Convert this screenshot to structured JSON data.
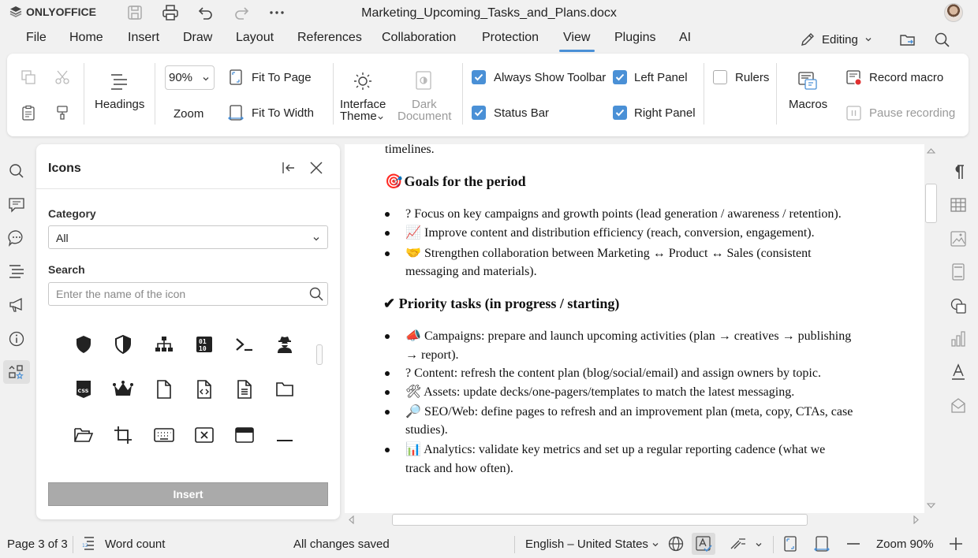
{
  "app": {
    "name": "ONLYOFFICE",
    "document_title": "Marketing_Upcoming_Tasks_and_Plans.docx"
  },
  "menu": {
    "items": [
      "File",
      "Home",
      "Insert",
      "Draw",
      "Layout",
      "References",
      "Collaboration",
      "Protection",
      "View",
      "Plugins",
      "AI"
    ],
    "active": "View",
    "mode_label": "Editing"
  },
  "toolbar": {
    "headings_label": "Headings",
    "zoom_value": "90%",
    "zoom_label": "Zoom",
    "fit_to_page": "Fit To Page",
    "fit_to_width": "Fit To Width",
    "interface_theme": [
      "Interface",
      "Theme"
    ],
    "dark_document": [
      "Dark",
      "Document"
    ],
    "checkboxes": {
      "always_show_toolbar": {
        "label": "Always Show Toolbar",
        "checked": true
      },
      "status_bar": {
        "label": "Status Bar",
        "checked": true
      },
      "left_panel": {
        "label": "Left Panel",
        "checked": true
      },
      "right_panel": {
        "label": "Right Panel",
        "checked": true
      },
      "rulers": {
        "label": "Rulers",
        "checked": false
      }
    },
    "macros_label": "Macros",
    "record_macro": "Record macro",
    "pause_recording": "Pause recording"
  },
  "icons_panel": {
    "title": "Icons",
    "category_label": "Category",
    "category_value": "All",
    "search_label": "Search",
    "search_placeholder": "Enter the name of the icon",
    "insert_label": "Insert",
    "icons": [
      "shield",
      "shield-half",
      "sitemap",
      "binary",
      "terminal",
      "user-secret",
      "css3",
      "crown",
      "file",
      "file-code",
      "file-lines",
      "folder",
      "folder-open",
      "crop",
      "keyboard",
      "rectangle-xmark",
      "window-maximize",
      "window-minimize"
    ]
  },
  "document": {
    "intro_fragment": "timelines.",
    "goals_heading": "Goals for the period",
    "goals": [
      {
        "icon": "?",
        "text": "Focus on key campaigns and growth points (lead generation / awareness / retention)."
      },
      {
        "icon": "📈",
        "text": "Improve content and distribution efficiency (reach, conversion, engagement)."
      },
      {
        "icon": "🤝",
        "line1": "Strengthen collaboration between Marketing ↔ Product ↔ Sales (consistent",
        "line2": "messaging and materials)."
      }
    ],
    "tasks_heading": "Priority tasks (in progress / starting)",
    "tasks": [
      {
        "icon": "📣",
        "line1": "Campaigns: prepare and launch upcoming activities (plan → creatives → publishing",
        "line2": "→ report)."
      },
      {
        "icon": "?",
        "line1": "Content: refresh the content plan (blog/social/email) and assign owners by topic."
      },
      {
        "icon": "🛠",
        "line1": "Assets: update decks/one-pagers/templates to match the latest messaging."
      },
      {
        "icon": "🔎",
        "line1": "SEO/Web: define pages to refresh and an improvement plan (meta, copy, CTAs, case",
        "line2": "studies)."
      },
      {
        "icon": "📊",
        "line1": "Analytics: validate key metrics and set up a regular reporting cadence (what we",
        "line2": "track and how often)."
      }
    ]
  },
  "status": {
    "page": "Page 3 of 3",
    "word_count": "Word count",
    "saved": "All changes saved",
    "language": "English – United States",
    "zoom": "Zoom 90%"
  },
  "colors": {
    "accent": "#4a90d6",
    "background": "#f1f1f1"
  }
}
